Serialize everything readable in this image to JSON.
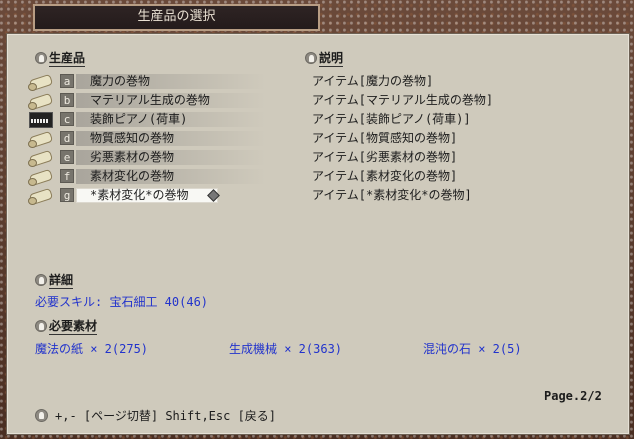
{
  "window": {
    "title": "生産品の選択"
  },
  "headers": {
    "product": "生産品",
    "description": "説明"
  },
  "items": [
    {
      "key": "a",
      "icon": "scroll-icon",
      "name": "魔力の巻物",
      "desc": "アイテム[魔力の巻物]"
    },
    {
      "key": "b",
      "icon": "scroll-icon",
      "name": "マテリアル生成の巻物",
      "desc": "アイテム[マテリアル生成の巻物]"
    },
    {
      "key": "c",
      "icon": "piano-icon",
      "name": "装飾ピアノ(荷車)",
      "desc": "アイテム[装飾ピアノ(荷車)]"
    },
    {
      "key": "d",
      "icon": "scroll-icon",
      "name": "物質感知の巻物",
      "desc": "アイテム[物質感知の巻物]"
    },
    {
      "key": "e",
      "icon": "scroll-icon",
      "name": "劣悪素材の巻物",
      "desc": "アイテム[劣悪素材の巻物]"
    },
    {
      "key": "f",
      "icon": "scroll-icon",
      "name": "素材変化の巻物",
      "desc": "アイテム[素材変化の巻物]"
    },
    {
      "key": "g",
      "icon": "scroll-icon",
      "name": "*素材変化*の巻物",
      "desc": "アイテム[*素材変化*の巻物]",
      "selected": true
    }
  ],
  "details": {
    "heading": "詳細",
    "skill": "必要スキル: 宝石細工 40(46)"
  },
  "materials": {
    "heading": "必要素材",
    "list": [
      "魔法の紙 × 2(275)",
      "生成機械 × 2(363)",
      "混沌の石 × 2(5)"
    ]
  },
  "page": "Page.2/2",
  "help": "+,- [ページ切替] Shift,Esc [戻る]",
  "colors": {
    "accent_text": "#2233cc",
    "panel": "#cfcabc",
    "frame": "#4a2e22"
  }
}
